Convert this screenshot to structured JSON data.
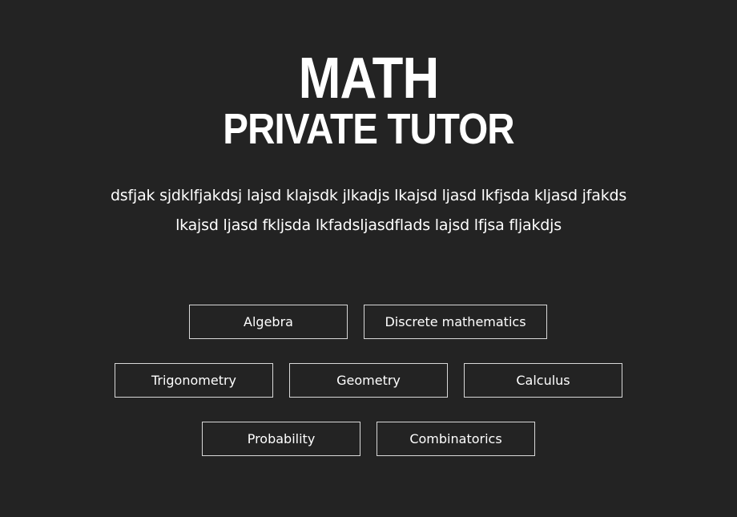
{
  "hero": {
    "title": "MATH",
    "subtitle": "PRIVATE TUTOR",
    "description_line1": "dsfjak sjdklfjakdsj lajsd klajsdk jlkadjs lkajsd ljasd lkfjsda kljasd jfakds",
    "description_line2": "lkajsd ljasd fkljsda lkfadsljasdflads lajsd lfjsa fljakdjs"
  },
  "subjects": {
    "algebra": "Algebra",
    "discrete": "Discrete mathematics",
    "trigonometry": "Trigonometry",
    "geometry": "Geometry",
    "calculus": "Calculus",
    "probability": "Probability",
    "combinatorics": "Combinatorics"
  },
  "colors": {
    "background": "#232323",
    "text": "#ffffff",
    "border": "#d8d8d8"
  }
}
